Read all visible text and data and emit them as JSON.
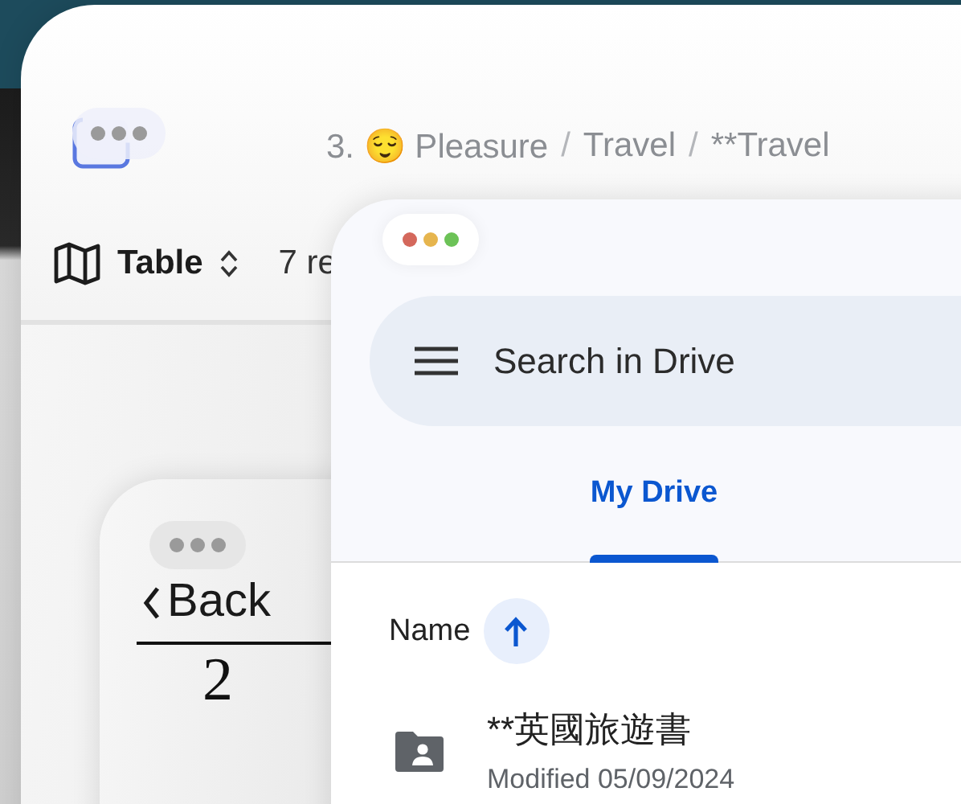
{
  "notes_window": {
    "breadcrumb": [
      {
        "kind": "crumb",
        "text": "3. 😌 Pleasure"
      },
      {
        "kind": "separator",
        "text": "/"
      },
      {
        "kind": "crumb",
        "text": "Travel"
      },
      {
        "kind": "separator",
        "text": "/"
      },
      {
        "kind": "crumb",
        "text": "**Travel"
      }
    ],
    "view": {
      "label": "Table"
    },
    "record_count": "7 re"
  },
  "back_window": {
    "back_label": "Back",
    "fraction_denominator": "2"
  },
  "drive_window": {
    "search": {
      "placeholder": "Search in Drive"
    },
    "tabs": [
      {
        "label": "My Drive",
        "selected": true
      }
    ],
    "sort": {
      "label": "Name"
    },
    "files": [
      {
        "name": "**英國旅遊書",
        "modified": "Modified 05/09/2024"
      }
    ]
  }
}
